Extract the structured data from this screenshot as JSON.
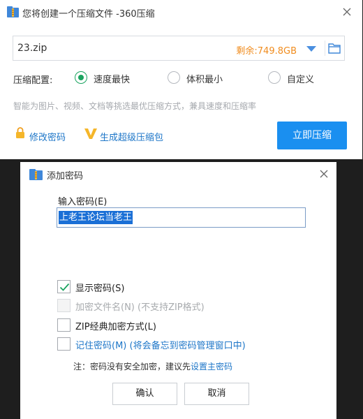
{
  "compress_window": {
    "title": "您将创建一个压缩文件 -360压缩",
    "file_path": "23.zip",
    "free_space": "剩余:749.8GB",
    "config_label": "压缩配置:",
    "options": [
      {
        "label": "速度最快",
        "selected": true
      },
      {
        "label": "体积最小",
        "selected": false
      },
      {
        "label": "自定义",
        "selected": false
      }
    ],
    "hint": "智能为图片、视频、文档等挑选最优压缩方式，兼具速度和压缩率",
    "modify_password": "修改密码",
    "super_package": "生成超级压缩包",
    "compress_button": "立即压缩"
  },
  "password_dialog": {
    "title": "添加密码",
    "input_label": "输入密码(E)",
    "input_value": "上老王论坛当老王",
    "checkboxes": [
      {
        "label": "显示密码(S)",
        "checked": true,
        "enabled": true
      },
      {
        "label": "加密文件名(N) (不支持ZIP格式)",
        "checked": false,
        "enabled": false
      },
      {
        "label": "ZIP经典加密方式(L)",
        "checked": false,
        "enabled": true
      },
      {
        "label": "记住密码(M) (将会备忘到密码管理窗口中)",
        "checked": false,
        "enabled": true
      }
    ],
    "note_prefix": "注：密码没有安全加密，建议先",
    "note_link": "设置主密码",
    "ok_label": "确认",
    "cancel_label": "取消"
  },
  "colors": {
    "accent_blue": "#1a8ff0",
    "link_blue": "#1d76c8",
    "radio_green": "#1aa35f",
    "free_space_orange": "#f08c1e",
    "backdrop": "#1e1e1e"
  }
}
